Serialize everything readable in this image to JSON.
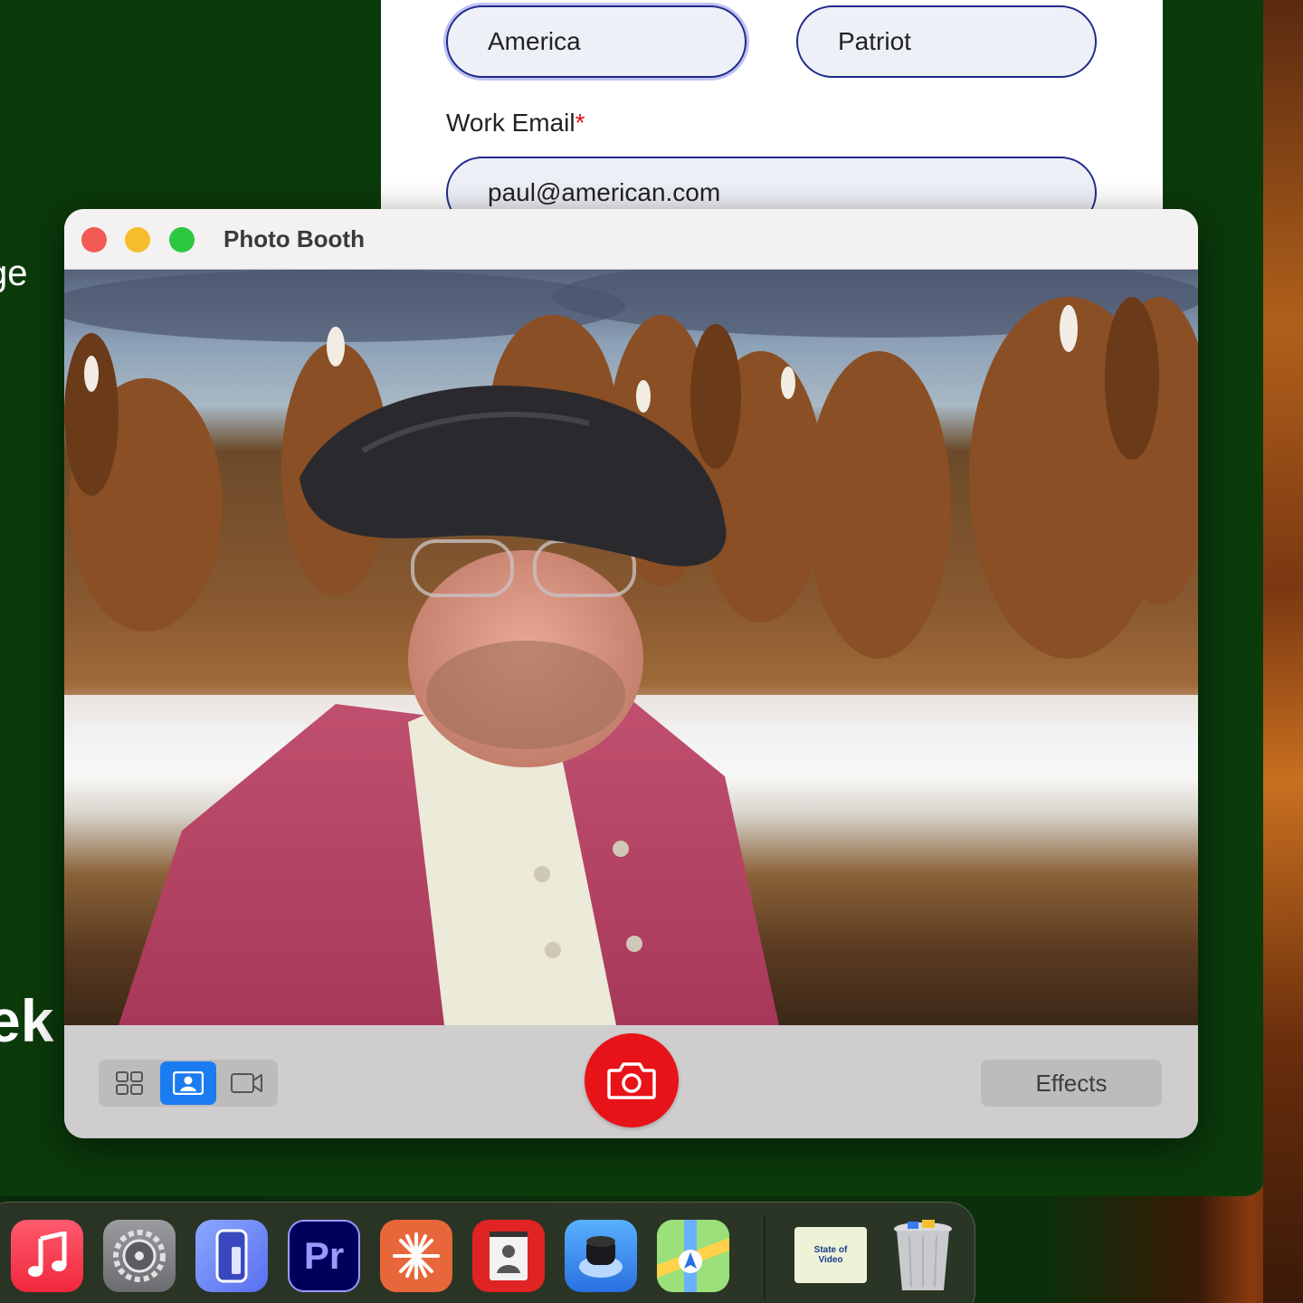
{
  "background": {
    "left_edge_text_top": "ge",
    "left_edge_text_bottom": "ek"
  },
  "form": {
    "first_name_value": "America",
    "last_name_value": "Patriot",
    "email_label": "Work Email",
    "email_required_mark": "*",
    "email_value": "paul@american.com"
  },
  "photo_booth": {
    "title": "Photo Booth",
    "modes": [
      {
        "name": "grid-view",
        "icon": "grid-icon",
        "active": false
      },
      {
        "name": "single-photo",
        "icon": "portrait-icon",
        "active": true
      },
      {
        "name": "video",
        "icon": "video-camera-icon",
        "active": false
      }
    ],
    "shutter_icon": "camera-icon",
    "effects_label": "Effects",
    "colors": {
      "shutter": "#e81318",
      "active_mode": "#1a7cf0",
      "close": "#f25a55",
      "minimize": "#f6be2d",
      "zoom": "#2bc840"
    }
  },
  "dock": {
    "apps": [
      {
        "name": "Music",
        "icon": "music-note-icon"
      },
      {
        "name": "System Settings",
        "icon": "gear-icon"
      },
      {
        "name": "iPhone Mirroring",
        "icon": "phone-icon"
      },
      {
        "name": "Premiere Pro",
        "icon": "premiere-icon",
        "text": "Pr"
      },
      {
        "name": "Claude",
        "icon": "starburst-icon"
      },
      {
        "name": "Photo Booth",
        "icon": "photo-booth-icon"
      },
      {
        "name": "Camo",
        "icon": "webcam-icon"
      },
      {
        "name": "Maps",
        "icon": "maps-icon"
      }
    ],
    "documents": [
      {
        "name": "State of Video",
        "icon": "document-thumbnail-icon",
        "text": "State of Video"
      },
      {
        "name": "Trash",
        "icon": "trash-icon"
      }
    ]
  }
}
